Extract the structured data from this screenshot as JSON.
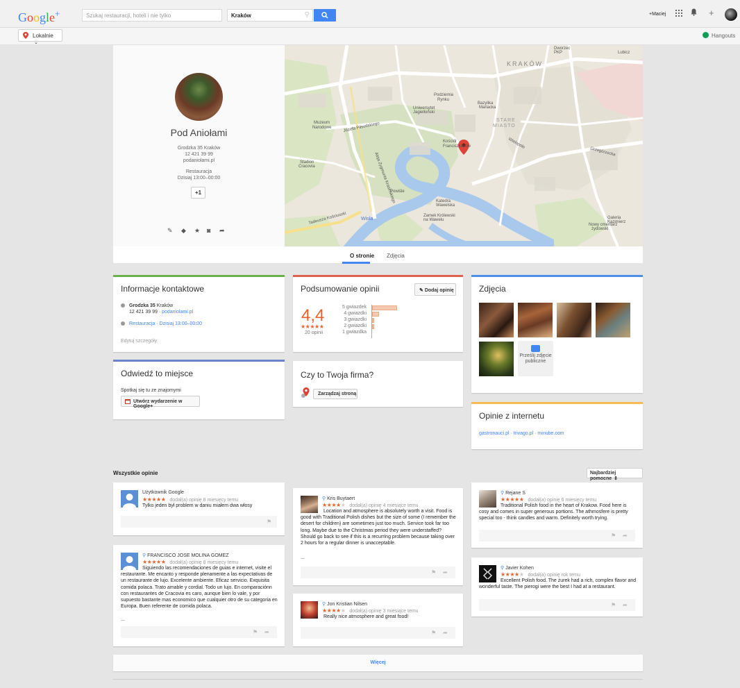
{
  "header": {
    "logo": "Google+",
    "search_placeholder": "Szukaj restauracji, hoteli i nie tylko",
    "location_value": "Kraków",
    "user_name": "+Maciej"
  },
  "subbar": {
    "local_label": "Lokalnie",
    "hangouts_label": "Hangouts"
  },
  "place": {
    "name": "Pod Aniołami",
    "address": "Grodzka 35 Kraków",
    "phone": "12 421 39 99",
    "website": "podaniolami.pl",
    "category": "Restauracja",
    "hours": "Dzisiaj 13:00–00:00",
    "plus_one": "+1"
  },
  "map": {
    "labels": [
      "KRAKÓW",
      "STARE MIASTO",
      "Wisła",
      "Podzamcze",
      "Bazylika Mariacka",
      "Kościół Franciszkanów",
      "Katedra Wawelska",
      "Zamek Królewski na Wawelu",
      "Stadion Cracovia",
      "Muzeum Narodowe",
      "Uniwersytet Jagielloński",
      "Powiśle",
      "Grzegórzecka",
      "Wielopole",
      "Dworzec PKP",
      "Lubicz",
      "Józefa Piłsudskiego",
      "Aleja Zygmunta Krasińskiego",
      "Tadeusza Kościuszki",
      "Nowy cmentarz żydowski",
      "Galeria Kazimierz"
    ]
  },
  "tabs": [
    "O stronie",
    "Zdjęcia"
  ],
  "contact": {
    "title": "Informacje kontaktowe",
    "street_bold": "Grodzka 35",
    "city": "Kraków",
    "phone_line": "12 421 39 99 · ",
    "website": "podaniolami.pl",
    "category_hours": "Restauracja · Dzisiaj 13:00–00:00",
    "edit": "Edytuj szczegóły"
  },
  "summary": {
    "title": "Podsumowanie opinii",
    "add_button": "Dodaj opinię",
    "rating": "4,4",
    "count": "20 opinii",
    "histogram": [
      {
        "label": "5 gwiazdek",
        "value": 14
      },
      {
        "label": "4 gwiazdki",
        "value": 4
      },
      {
        "label": "3 gwiazdki",
        "value": 1
      },
      {
        "label": "2 gwiazdki",
        "value": 1
      },
      {
        "label": "1 gwiazdka",
        "value": 0
      }
    ]
  },
  "photos": {
    "title": "Zdjęcia",
    "upload_label": "Prześlij zdjęcie publiczne"
  },
  "visit": {
    "title": "Odwiedź to miejsce",
    "subtitle": "Spotkaj się tu ze znajomymi",
    "event_button": "Utwórz wydarzenie w Google+"
  },
  "business": {
    "title": "Czy to Twoja firma?",
    "manage_button": "Zarządzaj stroną"
  },
  "web_reviews": {
    "title": "Opinie z internetu",
    "links": "gastronauci.pl · trivago.pl · minube.com"
  },
  "reviews_section": {
    "title": "Wszystkie opinie",
    "sort": "Najbardziej pomocne"
  },
  "reviews": [
    {
      "name": "Użytkownik Google",
      "stars": 5,
      "meta": "dodał(a) opinię 8 miesięcy temu",
      "text": "Tylko jeden był problem w daniu miałem dwa włosy"
    },
    {
      "name": "FRANCISCO JOSE MOLINA GOMEZ",
      "stars": 5,
      "meta": "dodał(a) opinię 8 miesięcy temu",
      "text": "Siguiendo las recomendaciones de guias e internet, visite el restaurante. Me encanto y responde plenamente a las expectativas de un restaurante de lujo. Excelente ambiente. Eficaz servicio. Exquisita comida polaca. Trato amable y cordial. Todo un lujo. En comparaciónn con restaurantes de Cracovia es caro, aunque bien lo vale, y por supuesto bastante mas economico que cualquier otro de su categoria en Europa. Buen referente de comida polaca.",
      "ellipsis": "..."
    },
    {
      "name": "Kris Buytaert",
      "stars": 4,
      "meta": "dodał(a) opinię 4 miesiące temu",
      "text": "Location and atmosphere is absolutely worth a visit. Food is good with Traditional Polish dishes but the size of some (I remember the desert for children) are sometimes just too much. Service took far too long. Maybe due to the Christmas period they were understaffed? Should go back to see if this is a recurring problem because taking over 2 hours for a regular dinner is unacceptable.",
      "ellipsis": "..."
    },
    {
      "name": "Jon Kristian Nilsen",
      "stars": 4,
      "meta": "dodał(a) opinię 3 miesiące temu",
      "text": "Really nice atmosphere and great food!"
    },
    {
      "name": "Rejane S",
      "stars": 5,
      "meta": "dodał(a) opinię 6 miesięcy temu",
      "text": "Traditional Polish food in the heart of Krakow. Food here is cosy and comes in super generous portions. The athmosfere is pretty special too - think candles and warm. Definitely worth trying."
    },
    {
      "name": "Javier Kohen",
      "stars": 4,
      "meta": "dodał(a) opinię rok temu",
      "text": "Excellent Polish food. The żurek had a rich, complex flavor and wonderful taste. The pierogi were the best I had at a restaurant."
    }
  ],
  "more_label": "Więcej",
  "colors": {
    "accent": "#4285f4",
    "rating": "#e5632c",
    "contact_bar": "#6ab04c",
    "summary_bar": "#e06050",
    "photos_bar": "#4e8ee8",
    "visit_bar": "#6b83c9",
    "web_bar": "#f5b955"
  }
}
